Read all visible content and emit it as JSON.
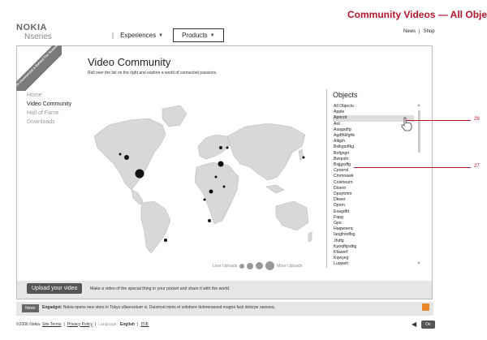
{
  "spec_title": "Community Videos — All Objects",
  "brand": {
    "name": "NOKIA",
    "line": "Nseries"
  },
  "nav": {
    "separator": "|",
    "experiences": "Experiences",
    "products": "Products"
  },
  "util": {
    "news": "News",
    "separator": "|",
    "shop": "Shop"
  },
  "ribbon": "TV Commercial & Behind The Scenes",
  "header": {
    "title": "Video Community",
    "subtitle": "Roll over the list on the right and explore a world of connected passions."
  },
  "sidebar": {
    "items": [
      "Home",
      "Video Community",
      "Hall of Fame",
      "Downloads"
    ]
  },
  "legend": {
    "less": "Less Uploads",
    "more": "More Uploads"
  },
  "objects": {
    "title": "Objects",
    "items": [
      "All Objects",
      "Apple",
      "Apricot",
      "Ant",
      "Asagsdfg",
      "Agdfhkfghk",
      "Alkjph",
      "Bslkgsdfkg",
      "Bofgngn",
      "Bwqsdn",
      "Bsjjgsdfg",
      "Cpoerol",
      "Cmmnawk",
      "Cosiheurn",
      "Dioern",
      "Dpojrtmm",
      "Dkwer",
      "Dpom",
      "Esagdfd",
      "Fapg",
      "Gpo",
      "Haqwoerq",
      "Iasgfnsdfsg",
      "Jhdfg",
      "Kpoqfkjsdkg",
      "Kfawerf",
      "Kqwyeg",
      "Luqweh"
    ],
    "highlighted": "Apricot"
  },
  "callouts": [
    "28",
    "27"
  ],
  "upload": {
    "button": "Upload your video",
    "text": "Make a video of the special thing in your pocket and share it with the world."
  },
  "news": {
    "tag": "News",
    "source": "Engadget:",
    "headline": "Nokia opens new store in Tokyo ullaoreetuer si. Duismod minis et volobore doloreraesed magna facil dolorpe raesseq."
  },
  "footer": {
    "copyright": "©2006 Nokia",
    "terms": "Site Terms",
    "sep": "|",
    "privacy": "Privacy Policy",
    "language_label": "Language:",
    "language": "English",
    "alt_language": "日本",
    "sound": "On"
  },
  "colors": {
    "accent": "#b5162b",
    "map_land": "#d8d8d8",
    "bubble": "#111111"
  }
}
